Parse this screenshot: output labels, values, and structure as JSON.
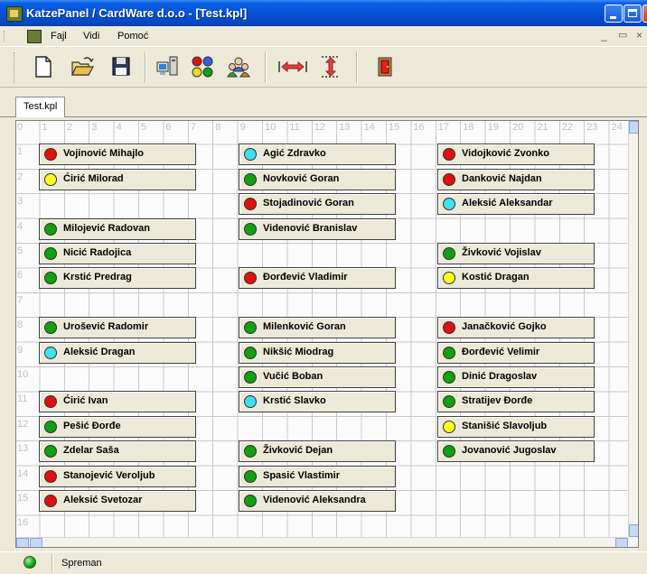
{
  "window": {
    "title": "KatzePanel / CardWare d.o.o - [Test.kpl]"
  },
  "menu": {
    "items": [
      "Fajl",
      "Vidi",
      "Pomoć"
    ]
  },
  "toolbar": {
    "buttons": [
      "new-file-icon",
      "open-folder-icon",
      "save-disk-icon",
      "computers-icon",
      "colored-dots-icon",
      "users-group-icon",
      "horizontal-resize-icon",
      "vertical-resize-icon",
      "exit-door-icon"
    ]
  },
  "tabs": [
    {
      "label": "Test.kpl"
    }
  ],
  "ruler": {
    "columns": [
      "0",
      "1",
      "2",
      "3",
      "4",
      "5",
      "6",
      "7",
      "8",
      "9",
      "10",
      "11",
      "12",
      "13",
      "14",
      "15",
      "16",
      "17",
      "18",
      "19",
      "20",
      "21",
      "22",
      "23",
      "24"
    ],
    "rows": [
      "1",
      "2",
      "3",
      "4",
      "5",
      "6",
      "7",
      "8",
      "9",
      "10",
      "11",
      "12",
      "13",
      "14",
      "15",
      "16"
    ]
  },
  "colors": {
    "red": "#e01010",
    "green": "#10a010",
    "yellow": "#ffff20",
    "cyan": "#40e0f0"
  },
  "cards": [
    {
      "name": "Vojinović Mihajlo",
      "status": "red"
    },
    {
      "name": "Ćirić Milorad",
      "status": "yellow"
    },
    {
      "name": "Milojević Radovan",
      "status": "green"
    },
    {
      "name": "Nicić Radojica",
      "status": "green"
    },
    {
      "name": "Krstić Predrag",
      "status": "green"
    },
    {
      "name": "Urošević Radomir",
      "status": "green"
    },
    {
      "name": "Aleksić Dragan",
      "status": "cyan"
    },
    {
      "name": "Ćirić Ivan",
      "status": "red"
    },
    {
      "name": "Pešić Đorđe",
      "status": "green"
    },
    {
      "name": "Zdelar Saša",
      "status": "green"
    },
    {
      "name": "Stanojević Veroljub",
      "status": "red"
    },
    {
      "name": "Aleksić Svetozar",
      "status": "red"
    },
    {
      "name": "Agić Zdravko",
      "status": "cyan"
    },
    {
      "name": "Novković Goran",
      "status": "green"
    },
    {
      "name": "Stojadinović Goran",
      "status": "red"
    },
    {
      "name": "Videnović Branislav",
      "status": "green"
    },
    {
      "name": "Đorđević Vladimir",
      "status": "red"
    },
    {
      "name": "Milenković Goran",
      "status": "green"
    },
    {
      "name": "Nikšić Miodrag",
      "status": "green"
    },
    {
      "name": "Vučić Boban",
      "status": "green"
    },
    {
      "name": "Krstić Slavko",
      "status": "cyan"
    },
    {
      "name": "Živković Dejan",
      "status": "green"
    },
    {
      "name": "Spasić Vlastimir",
      "status": "green"
    },
    {
      "name": "Videnović Aleksandra",
      "status": "green"
    },
    {
      "name": "Vidojković Zvonko",
      "status": "red"
    },
    {
      "name": "Danković Najdan",
      "status": "red"
    },
    {
      "name": "Aleksić Aleksandar",
      "status": "cyan"
    },
    {
      "name": "Živković Vojislav",
      "status": "green"
    },
    {
      "name": "Kostić Dragan",
      "status": "yellow"
    },
    {
      "name": "Janačković Gojko",
      "status": "red"
    },
    {
      "name": "Đorđević Velimir",
      "status": "green"
    },
    {
      "name": "Dinić Dragoslav",
      "status": "green"
    },
    {
      "name": "Stratijev Đorđe",
      "status": "green"
    },
    {
      "name": "Stanišić Slavoljub",
      "status": "yellow"
    },
    {
      "name": "Jovanović Jugoslav",
      "status": "green"
    }
  ],
  "status": {
    "text": "Spreman"
  }
}
